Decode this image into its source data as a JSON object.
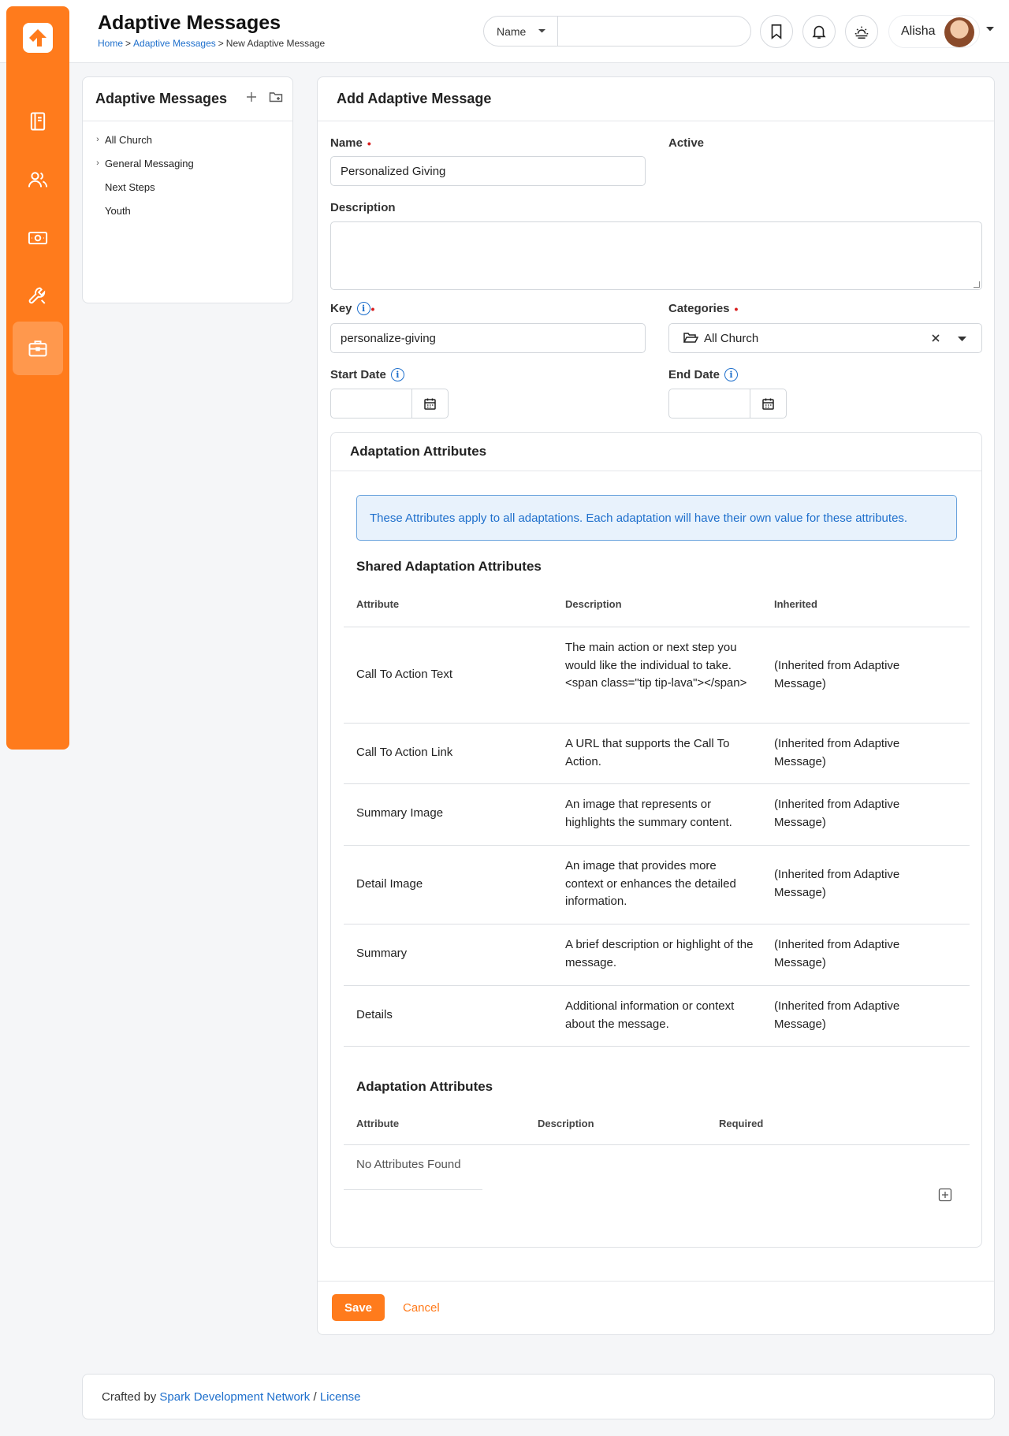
{
  "header": {
    "title": "Adaptive Messages",
    "breadcrumb": [
      "Home",
      "Adaptive Messages",
      "New Adaptive Message"
    ],
    "search": {
      "scope": "Name",
      "value": ""
    },
    "user_name": "Alisha"
  },
  "tree": {
    "title": "Adaptive Messages",
    "items": [
      {
        "label": "All Church",
        "expandable": true
      },
      {
        "label": "General Messaging",
        "expandable": true
      },
      {
        "label": "Next Steps",
        "expandable": false
      },
      {
        "label": "Youth",
        "expandable": false
      }
    ]
  },
  "form": {
    "title": "Add Adaptive Message",
    "name_label": "Name",
    "name_value": "Personalized Giving",
    "active_label": "Active",
    "active_checked": true,
    "description_label": "Description",
    "key_label": "Key",
    "key_value": "personalize-giving",
    "categories_label": "Categories",
    "categories_value": "All Church",
    "start_date_label": "Start Date",
    "end_date_label": "End Date"
  },
  "attributes_panel": {
    "title": "Adaptation Attributes",
    "alert": "These Attributes apply to all adaptations. Each adaptation will have their own value for these attributes.",
    "shared_title": "Shared Adaptation Attributes",
    "shared_columns": [
      "Attribute",
      "Description",
      "Inherited"
    ],
    "shared_rows": [
      {
        "attribute": "Call To Action Text",
        "description": "The main action or next step you would like the individual to take. <span class=\"tip tip-lava\"></span>",
        "inherited": "(Inherited from Adaptive Message)"
      },
      {
        "attribute": "Call To Action Link",
        "description": "A URL that supports the Call To Action.",
        "inherited": "(Inherited from Adaptive Message)"
      },
      {
        "attribute": "Summary Image",
        "description": "An image that represents or highlights the summary content.",
        "inherited": "(Inherited from Adaptive Message)"
      },
      {
        "attribute": "Detail Image",
        "description": "An image that provides more context or enhances the detailed information.",
        "inherited": "(Inherited from Adaptive Message)"
      },
      {
        "attribute": "Summary",
        "description": "A brief description or highlight of the message.",
        "inherited": "(Inherited from Adaptive Message)"
      },
      {
        "attribute": "Details",
        "description": "Additional information or context about the message.",
        "inherited": "(Inherited from Adaptive Message)"
      }
    ],
    "adaptation_title": "Adaptation Attributes",
    "adaptation_columns": [
      "Attribute",
      "Description",
      "Required"
    ],
    "empty_text": "No Attributes Found"
  },
  "actions": {
    "save": "Save",
    "cancel": "Cancel"
  },
  "footer": {
    "prefix": "Crafted by",
    "org": "Spark Development Network",
    "sep": "/",
    "license": "License"
  },
  "colors": {
    "brand": "#ff7b1c",
    "link": "#1e6fcc",
    "required": "#d81e1e"
  }
}
